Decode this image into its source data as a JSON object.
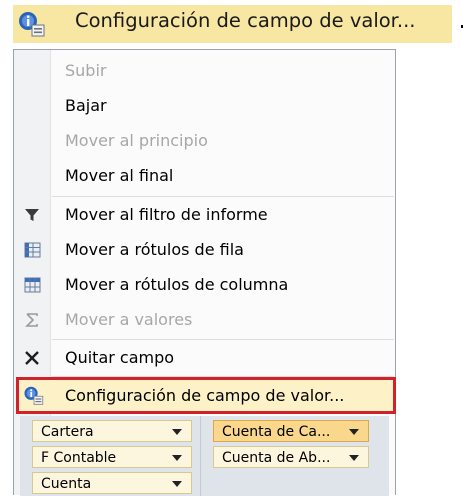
{
  "banner": {
    "icon": "field-settings-icon",
    "label": "Configuración de campo de valor..."
  },
  "menu": {
    "items": [
      {
        "label": "Subir",
        "enabled": false,
        "icon": ""
      },
      {
        "label": "Bajar",
        "enabled": true,
        "icon": ""
      },
      {
        "label": "Mover al principio",
        "enabled": false,
        "icon": ""
      },
      {
        "label": "Mover al final",
        "enabled": true,
        "icon": ""
      },
      {
        "label": "Mover al filtro de informe",
        "enabled": true,
        "icon": "filter-icon"
      },
      {
        "label": "Mover a rótulos de fila",
        "enabled": true,
        "icon": "row-labels-icon"
      },
      {
        "label": "Mover a rótulos de columna",
        "enabled": true,
        "icon": "column-labels-icon"
      },
      {
        "label": "Mover a valores",
        "enabled": false,
        "icon": "sigma-icon"
      },
      {
        "label": "Quitar campo",
        "enabled": true,
        "icon": "remove-x-icon"
      },
      {
        "label": "Configuración de campo de valor...",
        "enabled": true,
        "icon": "field-settings-icon",
        "highlighted": true
      }
    ]
  },
  "field_list": {
    "rows": [
      "Cartera",
      "F Contable",
      "Cuenta"
    ],
    "values": [
      "Cuenta de Ca...",
      "Cuenta de Ab..."
    ],
    "selected_value": "Cuenta de Ca..."
  },
  "colors": {
    "banner_bg": "#f8e7a2",
    "highlight_outline": "#d1222b",
    "selected_field_bg": "#f9d88e"
  }
}
